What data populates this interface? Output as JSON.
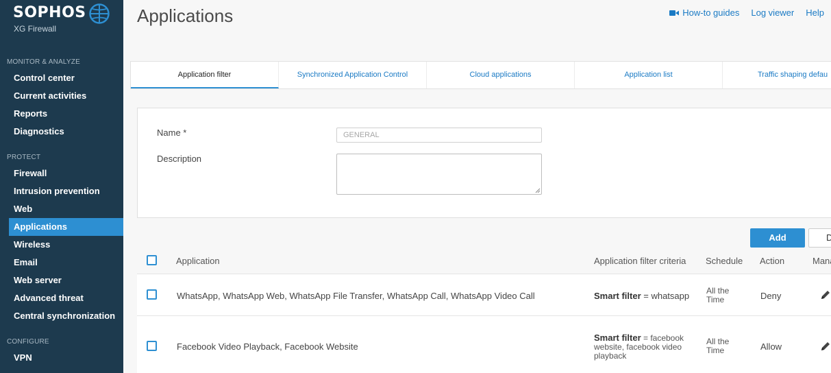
{
  "brand": {
    "name": "SOPHOS",
    "product": "XG Firewall"
  },
  "sidebar": {
    "sections": [
      {
        "title": "MONITOR & ANALYZE",
        "items": [
          "Control center",
          "Current activities",
          "Reports",
          "Diagnostics"
        ]
      },
      {
        "title": "PROTECT",
        "items": [
          "Firewall",
          "Intrusion prevention",
          "Web",
          "Applications",
          "Wireless",
          "Email",
          "Web server",
          "Advanced threat",
          "Central synchronization"
        ]
      },
      {
        "title": "CONFIGURE",
        "items": [
          "VPN"
        ]
      }
    ],
    "active_item": "Applications"
  },
  "header": {
    "title": "Applications",
    "links": {
      "howto": "How-to guides",
      "log_viewer": "Log viewer",
      "help": "Help"
    }
  },
  "tabs": [
    "Application filter",
    "Synchronized Application Control",
    "Cloud applications",
    "Application list",
    "Traffic shaping defau"
  ],
  "active_tab": "Application filter",
  "form": {
    "name_label": "Name *",
    "name_placeholder": "GENERAL",
    "description_label": "Description",
    "description_value": ""
  },
  "buttons": {
    "add": "Add",
    "delete": "D"
  },
  "table": {
    "columns": [
      "Application",
      "Application filter criteria",
      "Schedule",
      "Action",
      "Mana"
    ],
    "rows": [
      {
        "application": "WhatsApp, WhatsApp Web, WhatsApp File Transfer, WhatsApp Call, WhatsApp Video Call",
        "criteria_key": "Smart filter",
        "criteria_value": " = whatsapp",
        "schedule": "All the Time",
        "action": "Deny"
      },
      {
        "application": "Facebook Video Playback, Facebook Website",
        "criteria_key": "Smart filter",
        "criteria_value": " = facebook website, facebook video playback",
        "schedule": "All the Time",
        "action": "Allow"
      }
    ]
  },
  "colors": {
    "sidebar_bg": "#1d3a4e",
    "accent": "#2d8fd2",
    "link": "#1a7ac4"
  }
}
